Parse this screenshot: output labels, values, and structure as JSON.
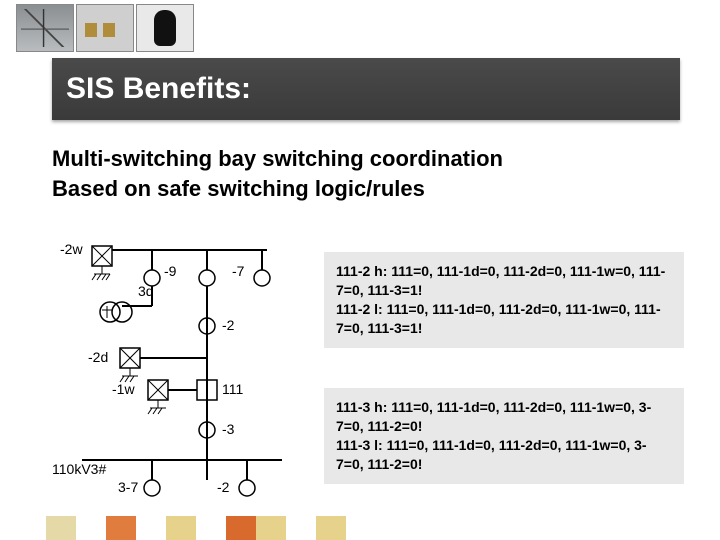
{
  "title": "SIS Benefits:",
  "subtitle": {
    "line1": "Multi-switching bay switching coordination",
    "line2": "Based on safe switching logic/rules"
  },
  "diagram": {
    "labels": {
      "top_left": "-2w",
      "top_mid": "-9",
      "top_right": "-7",
      "q1": "3d",
      "mid_right": "-2",
      "mid_left": "-2d",
      "center_box": "111",
      "lw": "-1w",
      "down": "-3",
      "bus": "110kV3#",
      "bl": "3-7",
      "br": "-2"
    }
  },
  "logic1": {
    "l1": "111-2 h: 111=0, 111-1d=0, 111-2d=0, 111-1w=0, 111-7=0, 111-3=1!",
    "l2": "111-2 l: 111=0, 111-1d=0, 111-2d=0, 111-1w=0, 111-7=0, 111-3=1!"
  },
  "logic2": {
    "l1": "111-3 h: 111=0, 111-1d=0, 111-2d=0, 111-1w=0, 3-7=0, 111-2=0!",
    "l2": "111-3 l: 111=0, 111-1d=0, 111-2d=0, 111-1w=0, 3-7=0, 111-2=0!"
  },
  "palette": [
    "#e6d9a8",
    "#ffffff",
    "#e07c3e",
    "#ffffff",
    "#e6d28a",
    "#ffffff",
    "#d86a2e",
    "#e6d28a",
    "#ffffff",
    "#e6d28a"
  ]
}
